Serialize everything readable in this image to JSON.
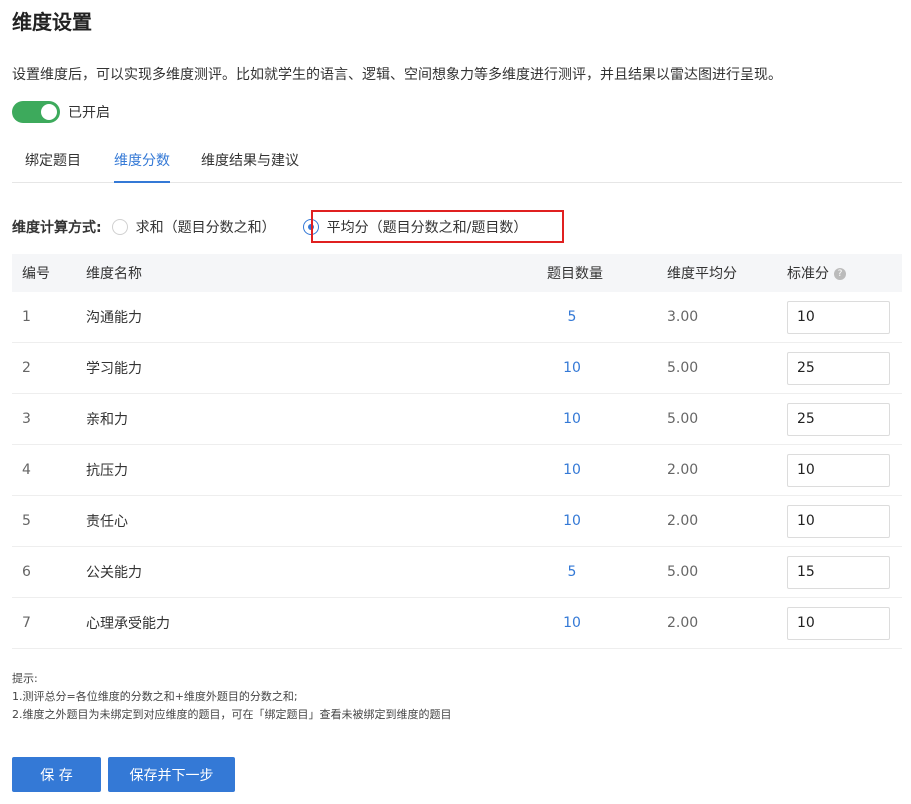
{
  "page": {
    "title": "维度设置",
    "description": "设置维度后，可以实现多维度测评。比如就学生的语言、逻辑、空间想象力等多维度进行测评，并且结果以雷达图进行呈现。",
    "toggle_label": "已开启"
  },
  "tabs": [
    {
      "label": "绑定题目"
    },
    {
      "label": "维度分数"
    },
    {
      "label": "维度结果与建议"
    }
  ],
  "calc": {
    "label": "维度计算方式:",
    "option_sum": "求和（题目分数之和）",
    "option_avg": "平均分（题目分数之和/题目数）"
  },
  "table": {
    "headers": [
      "编号",
      "维度名称",
      "题目数量",
      "维度平均分",
      "标准分"
    ],
    "rows": [
      {
        "no": "1",
        "name": "沟通能力",
        "count": "5",
        "avg": "3.00",
        "score": "10"
      },
      {
        "no": "2",
        "name": "学习能力",
        "count": "10",
        "avg": "5.00",
        "score": "25"
      },
      {
        "no": "3",
        "name": "亲和力",
        "count": "10",
        "avg": "5.00",
        "score": "25"
      },
      {
        "no": "4",
        "name": "抗压力",
        "count": "10",
        "avg": "2.00",
        "score": "10"
      },
      {
        "no": "5",
        "name": "责任心",
        "count": "10",
        "avg": "2.00",
        "score": "10"
      },
      {
        "no": "6",
        "name": "公关能力",
        "count": "5",
        "avg": "5.00",
        "score": "15"
      },
      {
        "no": "7",
        "name": "心理承受能力",
        "count": "10",
        "avg": "2.00",
        "score": "10"
      }
    ]
  },
  "tips": {
    "title": "提示:",
    "line1": "1.测评总分=各位维度的分数之和+维度外题目的分数之和;",
    "line2": "2.维度之外题目为未绑定到对应维度的题目，可在「绑定题目」查看未被绑定到维度的题目"
  },
  "buttons": {
    "save": "保 存",
    "save_next": "保存并下一步"
  },
  "colors": {
    "accent": "#3479d6",
    "toggle_on": "#3daa5c",
    "highlight": "#e02020"
  }
}
